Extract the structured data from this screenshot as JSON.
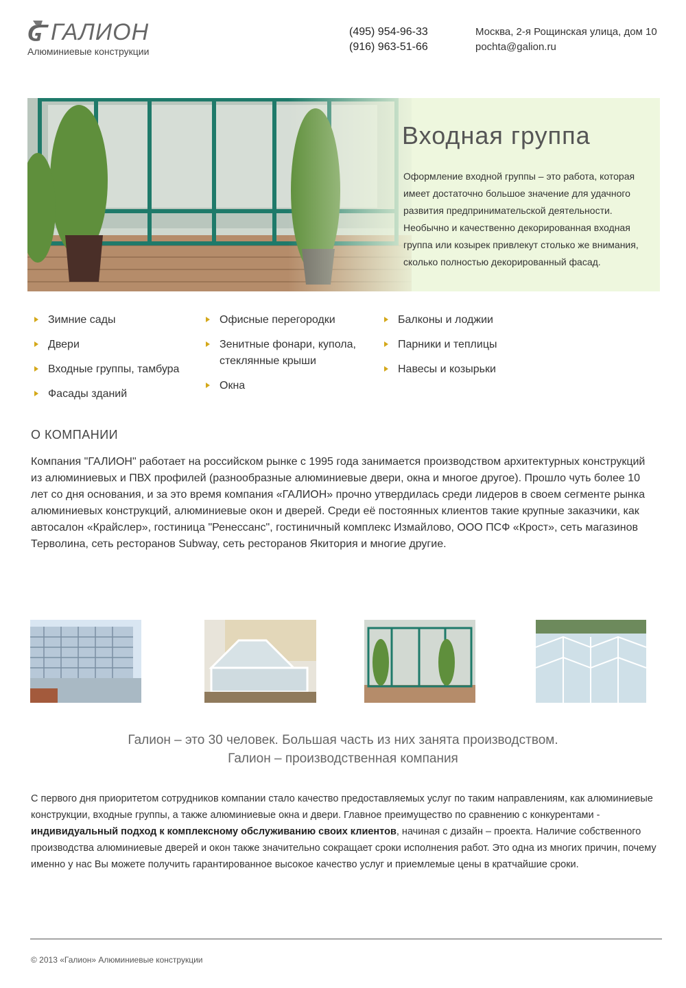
{
  "header": {
    "logo_text": "ГАЛИОН",
    "logo_subtitle": "Алюминиевые конструкции",
    "phone_1": "(495) 954-96-33",
    "phone_2": "(916) 963-51-66",
    "address": "Москва, 2-я Рощинская улица, дом 10",
    "email": "pochta@galion.ru"
  },
  "banner": {
    "title": "Входная группа",
    "text": "Оформление входной группы – это работа, которая имеет достаточно большое значение для удачного развития предпринимательской деятельности. Необычно и качественно декорированная входная группа или козырек привлекут столько же внимания, сколько полностью декорированный фасад."
  },
  "services": {
    "col1": [
      "Зимние сады",
      "Двери",
      "Входные группы, тамбура",
      "Фасады зданий"
    ],
    "col2": [
      "Офисные перегородки",
      "Зенитные фонари, купола, стеклянные крыши",
      "Окна"
    ],
    "col3": [
      "Балконы и лоджии",
      "Парники и теплицы",
      "Навесы и козырьки"
    ]
  },
  "about": {
    "title": "О КОМПАНИИ",
    "text": "Компания \"ГАЛИОН\" работает на российском рынке с 1995 года занимается производством архитектурных конструкций из алюминиевых и ПВХ профилей (разнообразные алюминиевые двери, окна и многое другое). Прошло чуть более 10 лет со дня основания, и за это время компания «ГАЛИОН» прочно утвердилась среди лидеров в своем сегменте рынка алюминиевых конструкций, алюминиевые окон и дверей. Среди её постоянных клиентов такие крупные заказчики, как автосалон «Крайслер», гостиница \"Ренессанс\", гостиничный комплекс Измайлово, ООО ПСФ «Крост», сеть магазинов Терволина, сеть ресторанов Subway, сеть ресторанов Якитория и многие другие."
  },
  "slogan": {
    "line1": "Галион – это 30 человек. Большая часть из них занята производством.",
    "line2": "Галион – производственная компания"
  },
  "body": {
    "part1": "С первого дня приоритетом сотрудников компании стало качество предоставляемых услуг по таким направлениям, как алюминиевые конструкции, входные группы, а также алюминиевые окна и двери. Главное преимущество по сравнению с конкурентами - ",
    "bold": "индивидуальный подход к комплексному обслуживанию своих клиентов",
    "part2": ", начиная с дизайн – проекта. Наличие собственного производства алюминиевые дверей и окон также значительно сокращает сроки исполнения работ. Это одна из многих причин, почему именно у нас Вы можете получить гарантированное высокое качество услуг и приемлемые цены в кратчайшие сроки."
  },
  "footer": {
    "text": "© 2013  «Галион»  Алюминиевые конструкции"
  },
  "colors": {
    "bullet": "#d4a81a",
    "banner_bg": "#eef7de",
    "frame_green": "#1f7a6a"
  }
}
